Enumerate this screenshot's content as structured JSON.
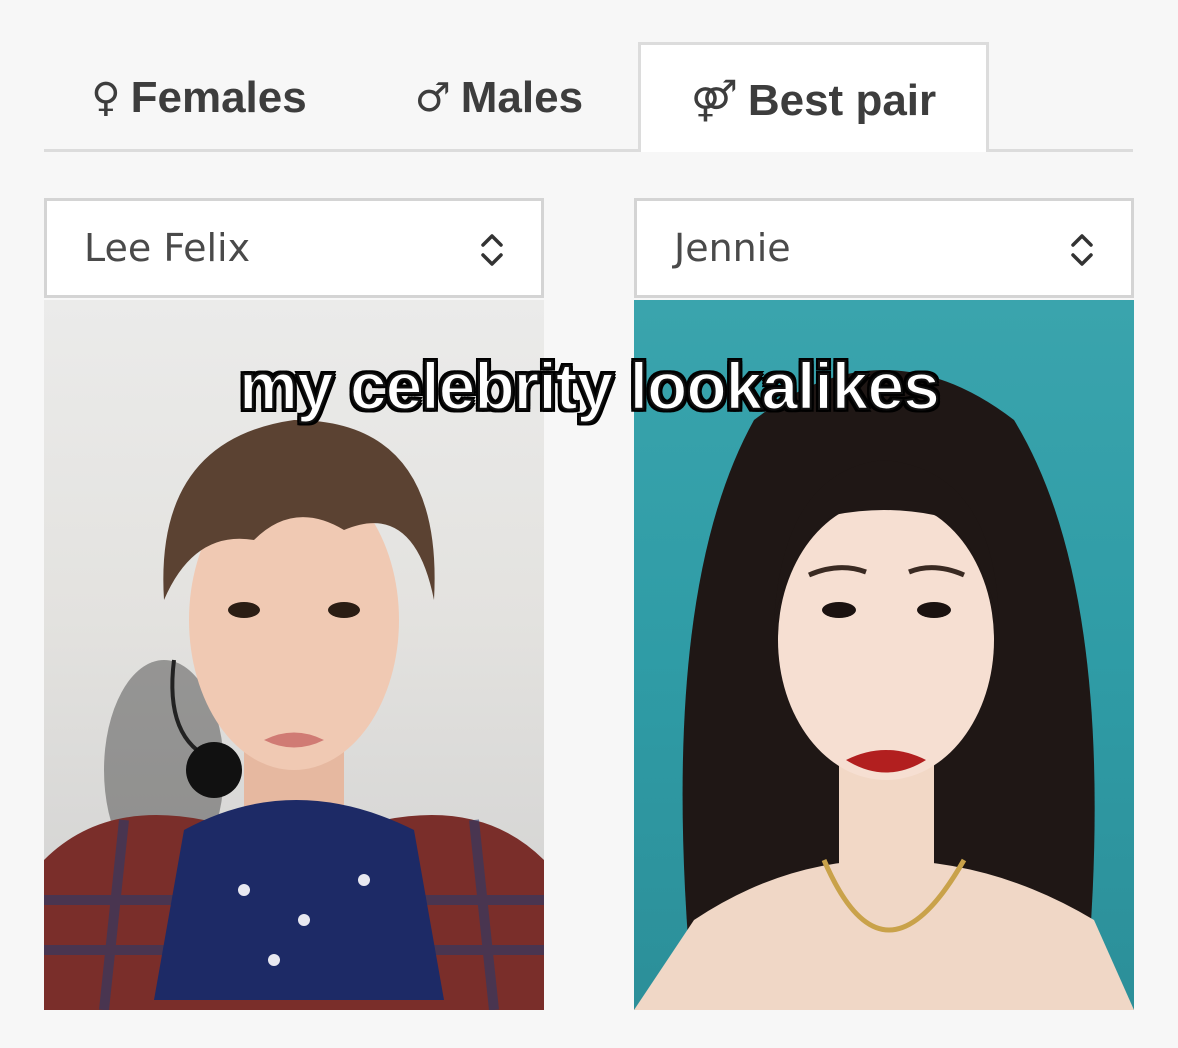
{
  "tabs": {
    "females": {
      "icon": "female-symbol-icon",
      "symbol": "♀",
      "label": "Females"
    },
    "males": {
      "icon": "male-symbol-icon",
      "symbol": "♂",
      "label": "Males"
    },
    "best_pair": {
      "icon": "female-male-symbol-icon",
      "symbol": "⚤",
      "label": "Best pair"
    },
    "active": "best_pair"
  },
  "selects": {
    "left": {
      "value": "Lee Felix",
      "icon": "chevron-up-down-icon"
    },
    "right": {
      "value": "Jennie",
      "icon": "chevron-up-down-icon"
    }
  },
  "photos": {
    "left_background": "#e7e6e3",
    "right_background": "#339fa9"
  },
  "overlay": {
    "caption": "my celebrity lookalikes"
  },
  "colors": {
    "page_background": "#f7f7f7",
    "tab_text": "#3d3d3d",
    "border": "#dcdcdc"
  }
}
